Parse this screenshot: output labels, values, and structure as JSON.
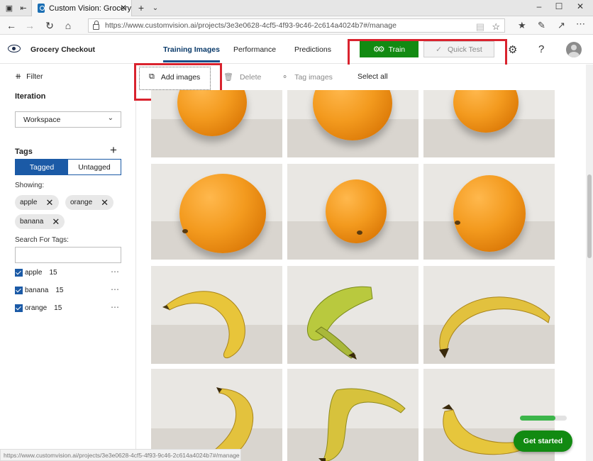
{
  "browser": {
    "tab_title": "Custom Vision: Grocery",
    "url": "https://www.customvision.ai/projects/3e3e0628-4cf5-4f93-9c46-2c614a4024b7#/manage",
    "status_url": "https://www.customvision.ai/projects/3e3e0628-4cf5-4f93-9c46-2c614a4024b7#/manage"
  },
  "header": {
    "project_name": "Grocery Checkout",
    "tabs": [
      {
        "label": "Training Images",
        "active": true
      },
      {
        "label": "Performance",
        "active": false
      },
      {
        "label": "Predictions",
        "active": false
      }
    ],
    "train_label": "Train",
    "quick_test_label": "Quick Test"
  },
  "sidebar": {
    "filter_label": "Filter",
    "iteration_heading": "Iteration",
    "iteration_value": "Workspace",
    "tags_heading": "Tags",
    "tagged_label": "Tagged",
    "untagged_label": "Untagged",
    "showing_label": "Showing:",
    "chips": [
      "apple",
      "orange",
      "banana"
    ],
    "search_label": "Search For Tags:",
    "search_value": "",
    "tags": [
      {
        "name": "apple",
        "count": "15"
      },
      {
        "name": "banana",
        "count": "15"
      },
      {
        "name": "orange",
        "count": "15"
      }
    ]
  },
  "toolbar": {
    "add_images": "Add images",
    "delete": "Delete",
    "tag_images": "Tag images",
    "select_all": "Select all"
  },
  "onboarding": {
    "progress": 0.75,
    "get_started": "Get started"
  },
  "colors": {
    "accent_blue": "#1b5aa6",
    "train_green": "#128a12",
    "highlight_red": "#d9232e"
  }
}
